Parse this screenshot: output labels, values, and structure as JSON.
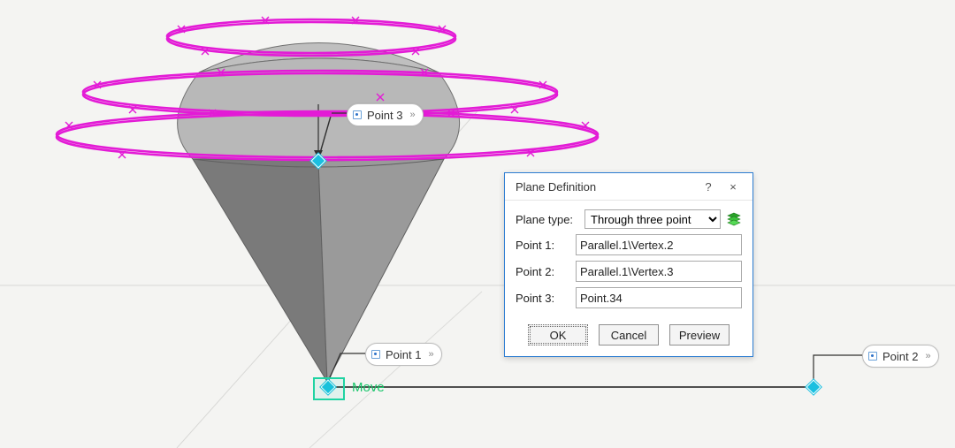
{
  "dialog": {
    "title": "Plane Definition",
    "help": "?",
    "close": "×",
    "type_label": "Plane type:",
    "type_value": "Through three point",
    "type_options": [
      "Through three point"
    ],
    "fields": [
      {
        "label": "Point 1:",
        "value": "Parallel.1\\Vertex.2"
      },
      {
        "label": "Point 2:",
        "value": "Parallel.1\\Vertex.3"
      },
      {
        "label": "Point 3:",
        "value": "Point.34"
      }
    ],
    "buttons": {
      "ok": "OK",
      "cancel": "Cancel",
      "preview": "Preview"
    }
  },
  "callouts": {
    "point1": "Point 1",
    "point2": "Point 2",
    "point3": "Point 3",
    "chev": "»"
  },
  "stage": {
    "move_label": "Move"
  },
  "colors": {
    "ellipse": "#e31bd6",
    "geom_fill1": "#8e8e8e",
    "geom_fill2": "#b9b9b9",
    "geom_edge": "#636363",
    "selection": "#1fd3a2",
    "vertex": "#1abfe0"
  }
}
